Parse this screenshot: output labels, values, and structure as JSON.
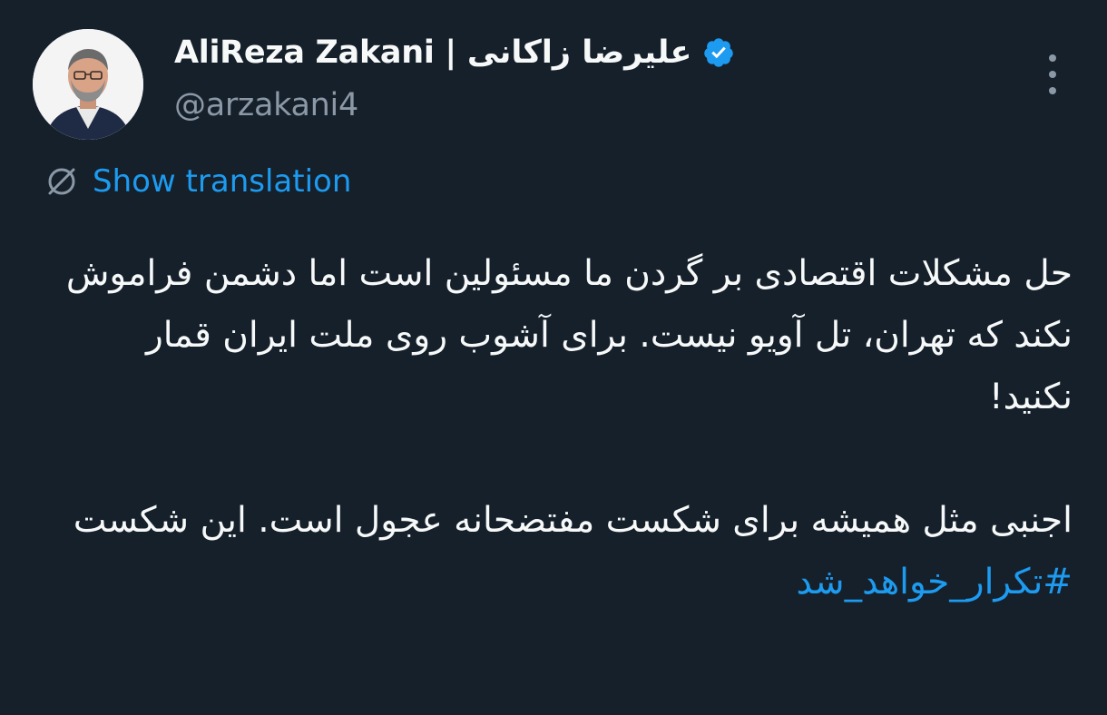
{
  "author": {
    "display_name": "AliReza Zakani | علیرضا زاکانی",
    "handle": "@arzakani4",
    "verified": true
  },
  "icons": {
    "avatar": "profile-photo",
    "verified": "verified-badge-icon",
    "more": "more-options-icon",
    "translate": "translate-globe-icon"
  },
  "colors": {
    "background": "#15202b",
    "primary_text": "#f7f9f9",
    "secondary_text": "#8b98a5",
    "accent": "#1d9bf0"
  },
  "translate": {
    "label": "Show translation"
  },
  "tweet": {
    "paragraph1": "حل مشکلات اقتصادی بر گردن ما مسئولین است اما دشمن فراموش نکند که تهران، تل آویو نیست. برای آشوب روی ملت ایران قمار نکنید!",
    "paragraph2_text": "اجنبی مثل همیشه برای شکست مفتضحانه عجول است. این شکست ",
    "hashtag": "#تکرار_خواهد_شد"
  }
}
